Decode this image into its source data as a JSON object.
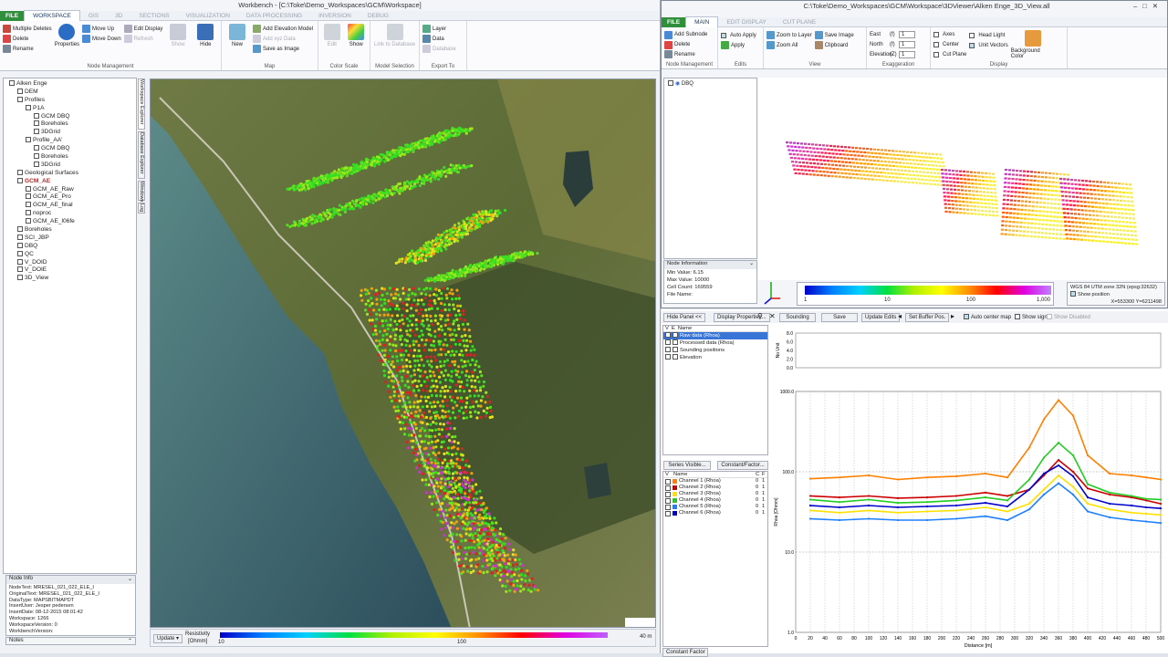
{
  "workbench": {
    "title": "Workbench - [C:\\Toke\\Demo_Workspaces\\GCM\\Workspace]",
    "tabs": [
      "FILE",
      "WORKSPACE",
      "GIS",
      "3D",
      "SECTIONS",
      "VISUALIZATION",
      "DATA PROCESSING",
      "INVERSION",
      "DEBUG"
    ],
    "ribbon": {
      "node_mgmt": {
        "multiple_deletes": "Multiple Deletes",
        "delete": "Delete",
        "rename": "Rename",
        "properties": "Properties",
        "move_up": "Move Up",
        "move_down": "Move Down",
        "edit_display": "Edit Display",
        "refresh": "Refresh",
        "show": "Show",
        "hide": "Hide",
        "caption": "Node Management"
      },
      "map": {
        "new": "New",
        "add_elevation": "Add Elevation Model",
        "add_xyz": "Add xyz Data",
        "save_image": "Save as Image",
        "caption": "Map"
      },
      "color_scale": {
        "edit": "Edit",
        "show": "Show",
        "caption": "Color Scale"
      },
      "model_sel": {
        "link": "Link to Database",
        "caption": "Model Selection"
      },
      "export": {
        "layer": "Layer",
        "data": "Data",
        "database": "Database",
        "caption": "Export To"
      }
    },
    "tree": [
      "Alken Enge",
      "DEM",
      "Profiles",
      "P1A",
      "GCM DBQ",
      "Boreholes",
      "3DGrid",
      "Profile_AA'",
      "GCM DBQ",
      "Boreholes",
      "3DGrid",
      "Geological Surfaces",
      "GCM_AE",
      "GCM_AE_Raw",
      "GCM_AE_Pro",
      "GCM_AE_final",
      "noproc",
      "GCM_AE_l06fe",
      "Boreholes",
      "SCI_JBP",
      "DBQ",
      "QC",
      "V_DOID",
      "V_DOIE",
      "3D_View"
    ],
    "side_tabs": [
      "Workspace Explorer",
      "Database Explorer",
      "Windows",
      "Log"
    ],
    "node_info": {
      "header": "Node Info",
      "lines": [
        "NodeText:  MRESEL_021_022_ELE_I",
        "OriginalText:  MRESEL_021_022_ELE_I",
        "DataType:  MAPSBITMAPDT",
        "InsertUser:  Jesper pedersen",
        "InsertDate:  08-12-2015 08:01:42",
        "Workspace:  1266",
        "WorkspaceVersion:  0",
        "WorkbenchVersion:"
      ]
    },
    "notes": "Notes",
    "map_footer": {
      "update": "Update",
      "label": "Resistivity",
      "unit": "[Ohmm]",
      "t10": "10",
      "t100": "100",
      "scale": "40 m"
    }
  },
  "viewer": {
    "title": "C:\\Toke\\Demo_Workspaces\\GCM\\Workspace\\3DViewer\\Alken  Enge_3D_View.all",
    "tabs": [
      "FILE",
      "MAIN",
      "EDIT DISPLAY",
      "CUT PLANE"
    ],
    "ribbon": {
      "node": {
        "add_subnode": "Add Subnode",
        "delete": "Delete",
        "rename": "Rename",
        "caption": "Node Management"
      },
      "edits": {
        "auto_apply": "Auto Apply",
        "apply": "Apply",
        "caption": "Edits"
      },
      "view": {
        "zoom_layer": "Zoom to Layer",
        "zoom_all": "Zoom All",
        "save_image": "Save Image",
        "clipboard": "Clipboard",
        "caption": "View"
      },
      "exag": {
        "east": "East",
        "north": "North",
        "elevation": "Elevation",
        "east_u": "(f)",
        "north_u": "(f)",
        "elev_u": "(Z)",
        "east_v": "1",
        "north_v": "1",
        "elev_v": "1",
        "caption": "Exaggeration"
      },
      "display": {
        "axes": "Axes",
        "center": "Center",
        "cut_plane": "Cut Plane",
        "head_light": "Head Light",
        "unit_vectors": "Unit Vectors",
        "bg": "Background Color",
        "caption": "Display"
      }
    },
    "node": "DBQ",
    "node_info": {
      "header": "Node Information",
      "min": "Min Value: 6.15",
      "max": "Max Value: 10000",
      "count": "Cell Count: 169559",
      "file": "File Name:"
    },
    "scale": {
      "t1": "1",
      "t10": "10",
      "t100": "100",
      "t1000": "1,000"
    },
    "coords": {
      "crs": "WGS 84 UTM zone 32N (epsg:32632)",
      "show": "Show position",
      "xy": "X=553300  Y=6211498"
    }
  },
  "sounding": {
    "toolbar": {
      "hide_panel": "Hide Panel <<",
      "display_props": "Display Properties...",
      "sounding": "Sounding",
      "save": "Save",
      "update_edits": "Update Edits",
      "set_buffer": "Set Buffer Pos.",
      "auto_center": "Auto center map",
      "show_sign": "Show sign",
      "show_disabled": "Show Disabled"
    },
    "layers_header": {
      "v": "V",
      "e": "E",
      "name": "Name"
    },
    "layers": [
      "Raw data (Rhoa)",
      "Processed data (Rhoa)",
      "Sounding positions",
      "Elevation"
    ],
    "series_visible": "Series Visible...",
    "constant_factor": "Constant/Factor...",
    "channels_header": {
      "v": "V",
      "name": "Name",
      "c": "C",
      "f": "F"
    },
    "channels": [
      {
        "name": "Channel 1 (Rhoa)",
        "c": "0",
        "f": "1",
        "color": "#ff7f00"
      },
      {
        "name": "Channel 2 (Rhoa)",
        "c": "0",
        "f": "1",
        "color": "#cc0000"
      },
      {
        "name": "Channel 3 (Rhoa)",
        "c": "0",
        "f": "1",
        "color": "#ffe000"
      },
      {
        "name": "Channel 4 (Rhoa)",
        "c": "0",
        "f": "1",
        "color": "#22cc22"
      },
      {
        "name": "Channel 5 (Rhoa)",
        "c": "0",
        "f": "1",
        "color": "#1e7fff"
      },
      {
        "name": "Channel 6 (Rhoa)",
        "c": "0",
        "f": "1",
        "color": "#0000cc"
      }
    ],
    "bottom_tab": "Constant Factor",
    "elev_ylabel": "No Unit",
    "elev_ticks": [
      "8.0",
      "6.0",
      "4.0",
      "2.0",
      "0.0"
    ],
    "rhoa_ylabel": "Rhoa [Ohmm]",
    "y_ticks": [
      "1000.0",
      "100.0",
      "10.0",
      "1.0"
    ],
    "xlabel": "Distance [m]",
    "x_ticks": [
      "0",
      "20",
      "40",
      "60",
      "80",
      "100",
      "120",
      "140",
      "160",
      "180",
      "200",
      "220",
      "240",
      "260",
      "280",
      "300",
      "320",
      "340",
      "360",
      "380",
      "400",
      "420",
      "440",
      "460",
      "480",
      "500"
    ]
  },
  "chart_data": {
    "type": "line",
    "xlabel": "Distance [m]",
    "ylabel": "Rhoa [Ohmm]",
    "yscale": "log",
    "xlim": [
      0,
      500
    ],
    "ylim": [
      1,
      1000
    ],
    "grid": true,
    "x": [
      20,
      60,
      100,
      140,
      180,
      220,
      260,
      290,
      320,
      340,
      360,
      380,
      400,
      430,
      460,
      480,
      500
    ],
    "series": [
      {
        "name": "Channel 1 (Rhoa)",
        "color": "#ff7f00",
        "values": [
          82,
          85,
          90,
          80,
          85,
          88,
          95,
          85,
          200,
          450,
          780,
          500,
          160,
          95,
          90,
          85,
          80
        ]
      },
      {
        "name": "Channel 2 (Rhoa)",
        "color": "#cc0000",
        "values": [
          50,
          48,
          50,
          47,
          48,
          50,
          55,
          50,
          60,
          90,
          140,
          100,
          62,
          52,
          48,
          44,
          40
        ]
      },
      {
        "name": "Channel 3 (Rhoa)",
        "color": "#ffe000",
        "values": [
          33,
          31,
          33,
          31,
          32,
          33,
          36,
          32,
          40,
          60,
          90,
          65,
          40,
          34,
          31,
          30,
          29
        ]
      },
      {
        "name": "Channel 4 (Rhoa)",
        "color": "#22cc22",
        "values": [
          45,
          42,
          45,
          41,
          42,
          44,
          48,
          44,
          80,
          150,
          230,
          160,
          70,
          55,
          50,
          46,
          45
        ]
      },
      {
        "name": "Channel 5 (Rhoa)",
        "color": "#1e7fff",
        "values": [
          26,
          25,
          26,
          25,
          25,
          26,
          28,
          25,
          34,
          52,
          72,
          52,
          32,
          27,
          25,
          24,
          23
        ]
      },
      {
        "name": "Channel 6 (Rhoa)",
        "color": "#0000cc",
        "values": [
          38,
          36,
          38,
          36,
          37,
          38,
          41,
          37,
          60,
          95,
          120,
          88,
          48,
          40,
          38,
          36,
          35
        ]
      }
    ]
  }
}
